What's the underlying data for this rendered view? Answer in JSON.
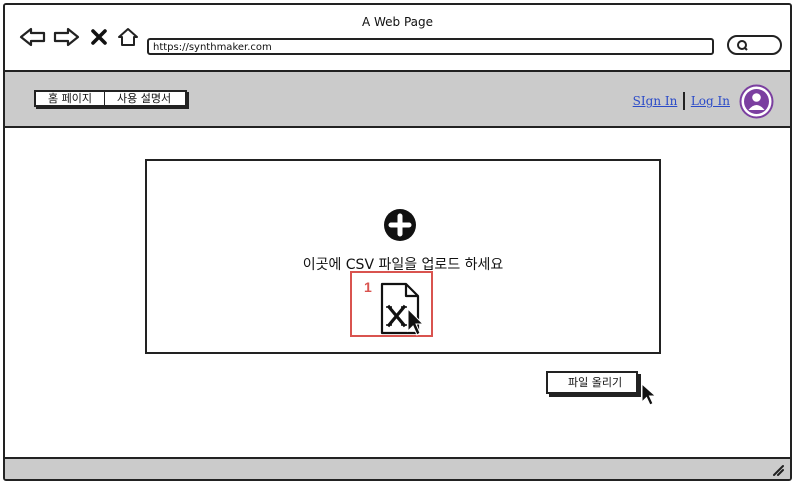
{
  "window": {
    "title": "A Web Page"
  },
  "browser": {
    "url": "https://synthmaker.com",
    "icons": [
      "back-arrow-icon",
      "forward-arrow-icon",
      "close-x-icon",
      "home-icon",
      "search-icon"
    ]
  },
  "navbar": {
    "tabs": [
      {
        "label": "홈 페이지"
      },
      {
        "label": "사용 설명서"
      }
    ],
    "sign_in": "SIgn In",
    "log_in": "Log In"
  },
  "upload": {
    "instruction": "이곳에 CSV 파일을 업로드 하세요",
    "highlight_number": "1",
    "button_label": "파일 올리기"
  },
  "colors": {
    "navbar_bg": "#cbcbcb",
    "link": "#2b4bc8",
    "avatar": "#7b3fa0",
    "highlight": "#d9534f"
  }
}
